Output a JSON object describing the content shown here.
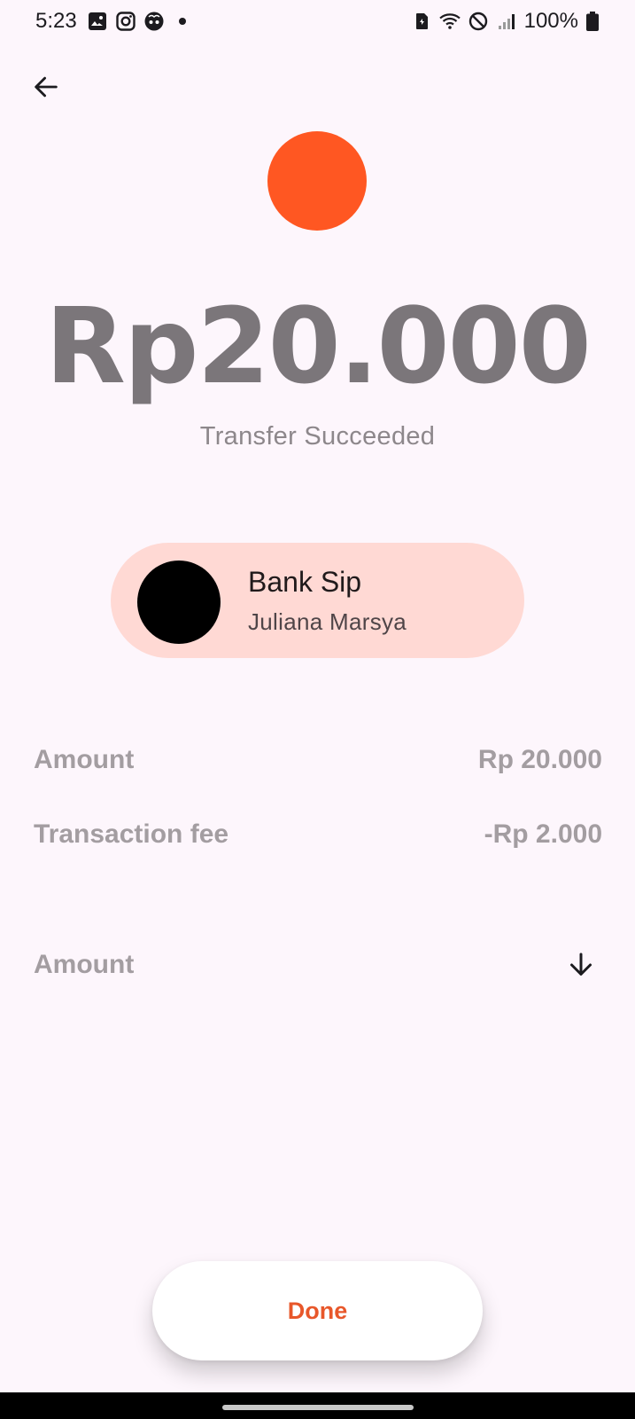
{
  "status_bar": {
    "time": "5:23",
    "battery": "100%",
    "left_icons": [
      "gallery-icon",
      "instagram-icon",
      "app-face-icon",
      "dot-icon"
    ],
    "right_icons": [
      "sim-icon",
      "wifi-icon",
      "do-not-disturb-icon",
      "signal-icon",
      "battery-icon"
    ]
  },
  "header": {
    "back_icon": "arrow-left-icon"
  },
  "transfer": {
    "amount": "Rp20.000",
    "status": "Transfer Succeeded",
    "accent_color": "#ff5722"
  },
  "bank": {
    "name": "Bank Sip",
    "holder": "Juliana Marsya",
    "card_color": "#ffd9d4"
  },
  "details": {
    "amount_label": "Amount",
    "amount_value": "Rp 20.000",
    "fee_label": "Transaction fee",
    "fee_value": "-Rp 2.000",
    "total_label": "Amount",
    "expand_icon": "arrow-down-icon"
  },
  "actions": {
    "done_label": "Done",
    "done_color": "#e8572a"
  }
}
